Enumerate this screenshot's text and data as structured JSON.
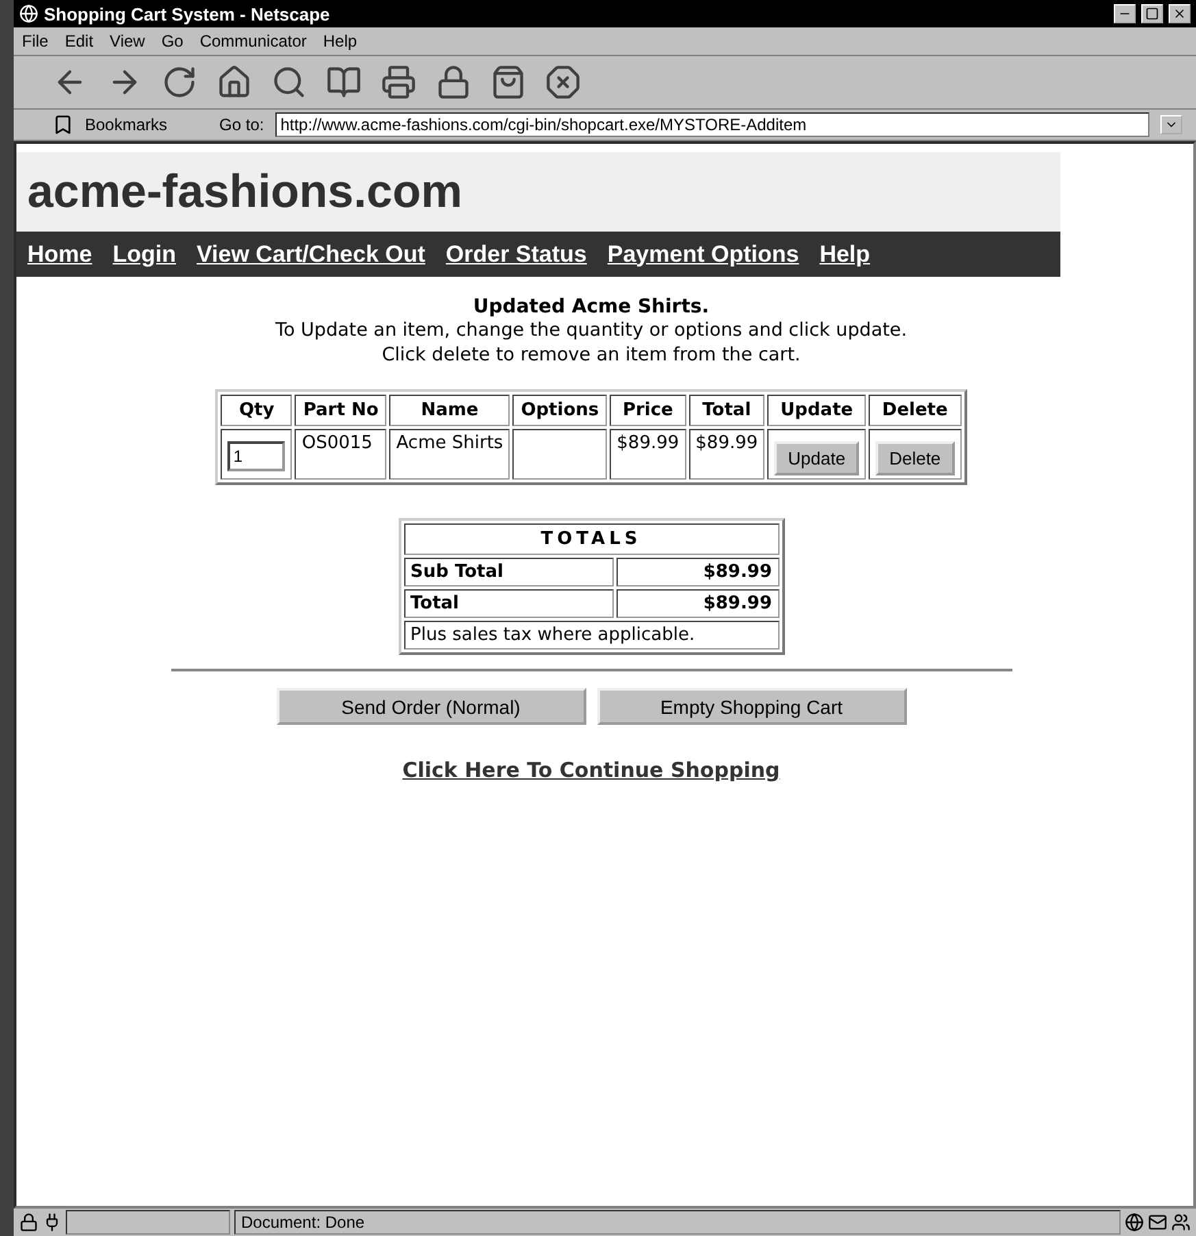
{
  "window": {
    "title": "Shopping Cart System - Netscape"
  },
  "menu": [
    "File",
    "Edit",
    "View",
    "Go",
    "Communicator",
    "Help"
  ],
  "location": {
    "bookmarks": "Bookmarks",
    "goto_label": "Go to:",
    "url": "http://www.acme-fashions.com/cgi-bin/shopcart.exe/MYSTORE-Additem"
  },
  "site": {
    "logo": "acme-fashions.com",
    "nav": [
      "Home",
      "Login",
      "View Cart/Check Out",
      "Order Status",
      "Payment Options",
      "Help"
    ]
  },
  "message": {
    "title": "Updated Acme Shirts.",
    "lines": [
      "To Update an item, change the quantity or options and click update.",
      "Click delete to remove an item from the cart."
    ]
  },
  "cart": {
    "columns": [
      "Qty",
      "Part No",
      "Name",
      "Options",
      "Price",
      "Total",
      "Update",
      "Delete"
    ],
    "rows": [
      {
        "qty": "1",
        "part_no": "OS0015",
        "name": "Acme Shirts",
        "price": "$89.99",
        "total": "$89.99",
        "update": "Update",
        "delete": "Delete"
      }
    ]
  },
  "totals": {
    "title": "TOTALS",
    "rows": [
      {
        "label": "Sub Total",
        "value": "$89.99"
      },
      {
        "label": "Total",
        "value": "$89.99"
      }
    ],
    "note": "Plus sales tax where applicable."
  },
  "buttons": [
    "Send Order (Normal)",
    "Empty Shopping Cart"
  ],
  "continue_link": "Click Here To Continue Shopping",
  "status_bar": {
    "text": "Document: Done"
  }
}
